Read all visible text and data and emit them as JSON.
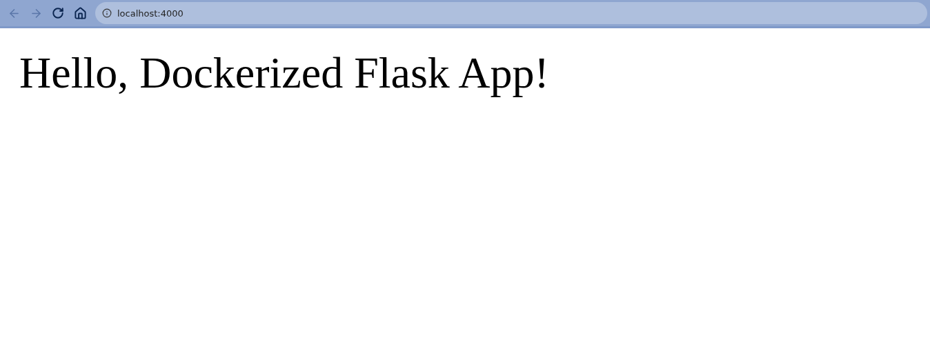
{
  "browser_toolbar": {
    "back": {
      "disabled": true
    },
    "forward": {
      "disabled": true
    },
    "address": "localhost:4000"
  },
  "page": {
    "heading": "Hello, Dockerized Flask App!"
  }
}
